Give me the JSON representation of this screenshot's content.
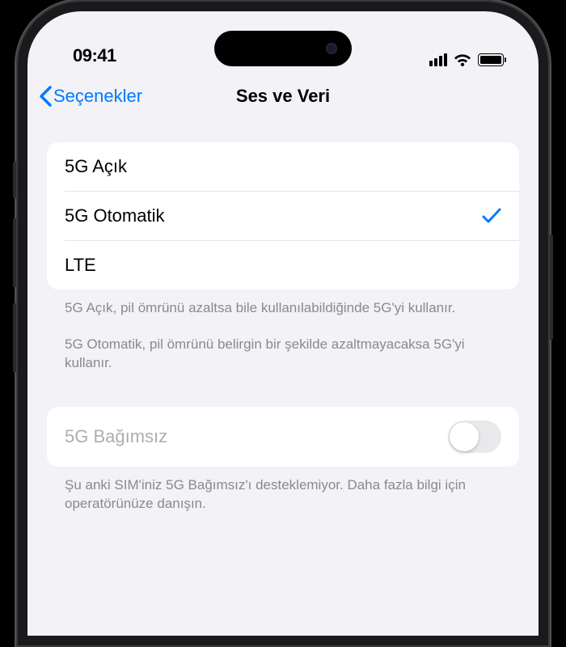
{
  "statusbar": {
    "time": "09:41"
  },
  "nav": {
    "back_label": "Seçenekler",
    "title": "Ses ve Veri"
  },
  "options": [
    {
      "label": "5G Açık",
      "selected": false
    },
    {
      "label": "5G Otomatik",
      "selected": true
    },
    {
      "label": "LTE",
      "selected": false
    }
  ],
  "footer": {
    "p1": "5G Açık, pil ömrünü azaltsa bile kullanılabildiğinde 5G'yi kullanır.",
    "p2": "5G Otomatik, pil ömrünü belirgin bir şekilde azaltmayacaksa 5G'yi kullanır."
  },
  "standalone": {
    "label": "5G Bağımsız",
    "enabled": false,
    "footer": "Şu anki SIM'iniz 5G Bağımsız'ı desteklemiyor. Daha fazla bilgi için operatörünüze danışın."
  }
}
